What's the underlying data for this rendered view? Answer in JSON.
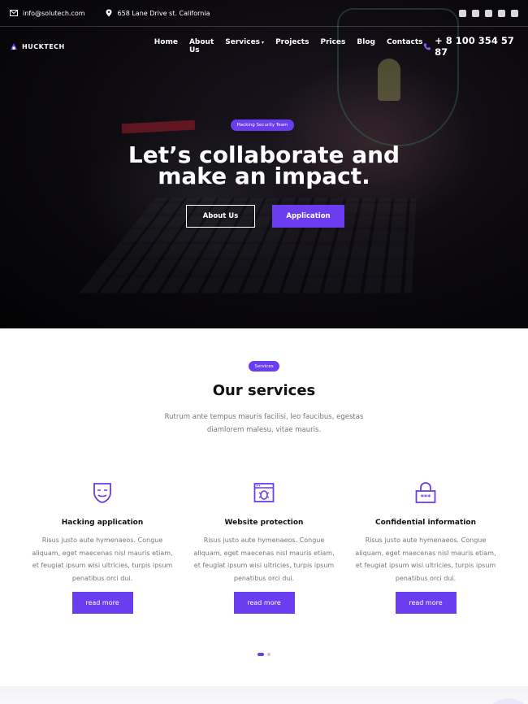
{
  "topbar": {
    "email": "info@solutech.com",
    "address": "658 Lane Drive st. California",
    "socials": [
      "facebook-icon",
      "twitter-icon",
      "youtube-icon",
      "github-icon",
      "linkedin-icon"
    ]
  },
  "nav": {
    "brand": "HUCKTECH",
    "items": [
      {
        "label": "Home"
      },
      {
        "label": "About Us"
      },
      {
        "label": "Services"
      },
      {
        "label": "Projects"
      },
      {
        "label": "Prices"
      },
      {
        "label": "Blog"
      },
      {
        "label": "Contacts"
      }
    ],
    "phone": "+ 8 100 354 57 87"
  },
  "hero": {
    "tag": "Hacking Security Team",
    "title_line1": "Let’s collaborate and",
    "title_line2": "make an impact.",
    "btn_about": "About Us",
    "btn_application": "Application"
  },
  "services": {
    "tag": "Services",
    "title": "Our services",
    "subtitle": "Rutrum ante tempus mauris facilisi, leo faucibus, egestas diamlorem malesu, vitae mauris.",
    "cards": [
      {
        "icon": "mask-icon",
        "title": "Hacking application",
        "text": "Risus justo aute hymenaeos. Congue aliquam, eget maecenas nisl mauris etiam, et feugiat ipsum wisi ultricies, turpis ipsum penatibus orci dui.",
        "button": "read more"
      },
      {
        "icon": "browser-bug-icon",
        "title": "Website protection",
        "text": "Risus justo aute hymenaeos. Congue aliquam, eget maecenas nisl mauris etiam, et feugiat ipsum wisi ultricies, turpis ipsum penatibus orci dui.",
        "button": "read more"
      },
      {
        "icon": "password-lock-icon",
        "title": "Confidential information",
        "text": "Risus justo aute hymenaeos. Congue aliquam, eget maecenas nisl mauris etiam, et feugiat ipsum wisi ultricies, turpis ipsum penatibus orci dui.",
        "button": "read more"
      }
    ]
  },
  "colors": {
    "accent": "#6a3df0",
    "text": "#111111",
    "muted": "#777777"
  }
}
